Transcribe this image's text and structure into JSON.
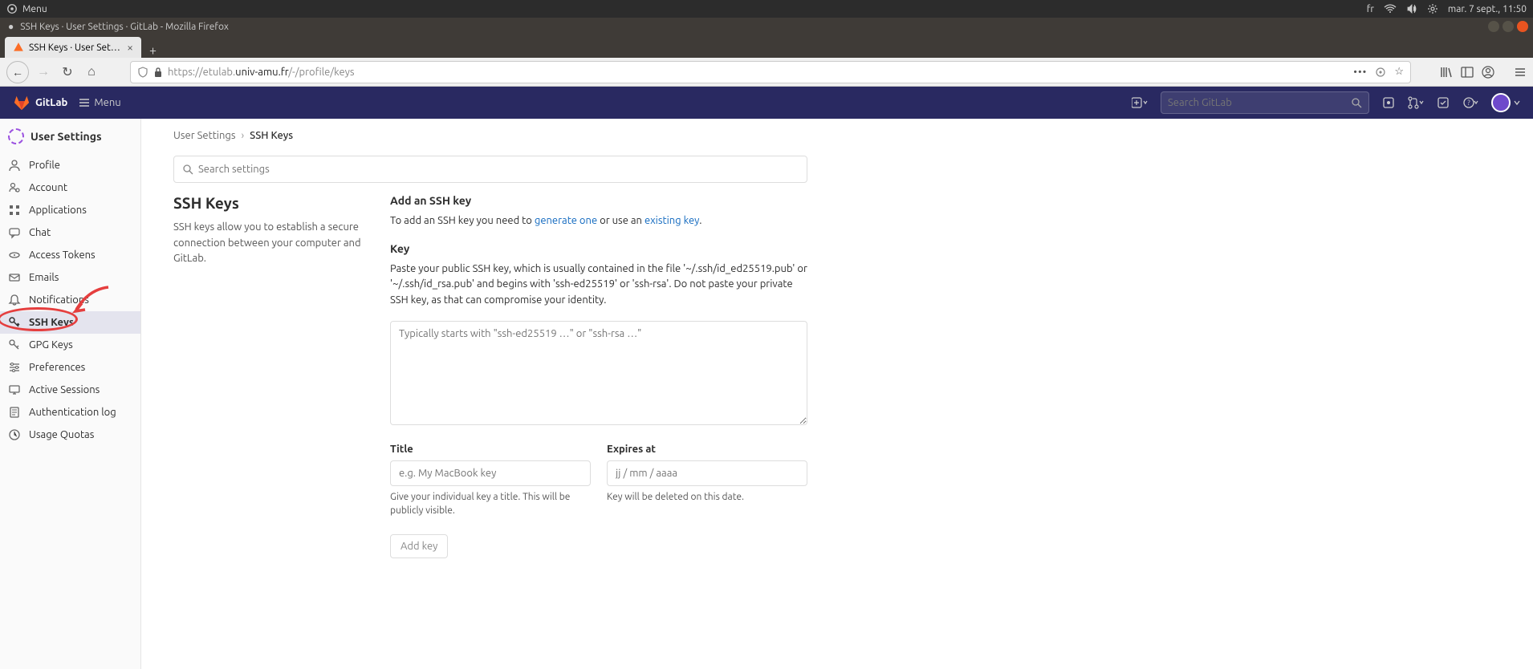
{
  "os": {
    "menu": "Menu",
    "lang": "fr",
    "date": "mar. 7 sept., 11:50"
  },
  "window": {
    "title": "SSH Keys · User Settings · GitLab - Mozilla Firefox"
  },
  "firefox": {
    "tab_title": "SSH Keys · User Settings",
    "url_proto": "https://",
    "url_host_grey1": "etulab.",
    "url_host_dark": "univ-amu.fr",
    "url_path": "/-/profile/keys"
  },
  "gitlab": {
    "brand": "GitLab",
    "menu_label": "Menu",
    "search_placeholder": "Search GitLab"
  },
  "sidebar": {
    "head": "User Settings",
    "items": [
      {
        "label": "Profile"
      },
      {
        "label": "Account"
      },
      {
        "label": "Applications"
      },
      {
        "label": "Chat"
      },
      {
        "label": "Access Tokens"
      },
      {
        "label": "Emails"
      },
      {
        "label": "Notifications"
      },
      {
        "label": "SSH Keys"
      },
      {
        "label": "GPG Keys"
      },
      {
        "label": "Preferences"
      },
      {
        "label": "Active Sessions"
      },
      {
        "label": "Authentication log"
      },
      {
        "label": "Usage Quotas"
      }
    ]
  },
  "breadcrumb": {
    "root": "User Settings",
    "current": "SSH Keys"
  },
  "page": {
    "search_placeholder": "Search settings",
    "heading": "SSH Keys",
    "heading_desc": "SSH keys allow you to establish a secure connection between your computer and GitLab.",
    "add_title": "Add an SSH key",
    "add_text_1": "To add an SSH key you need to ",
    "add_link_1": "generate one",
    "add_text_2": " or use an ",
    "add_link_2": "existing key",
    "add_text_3": ".",
    "key_label": "Key",
    "key_help": "Paste your public SSH key, which is usually contained in the file '~/.ssh/id_ed25519.pub' or '~/.ssh/id_rsa.pub' and begins with 'ssh-ed25519' or 'ssh-rsa'. Do not paste your private SSH key, as that can compromise your identity.",
    "key_placeholder": "Typically starts with \"ssh-ed25519 …\" or \"ssh-rsa …\"",
    "title_label": "Title",
    "title_placeholder": "e.g. My MacBook key",
    "title_hint": "Give your individual key a title. This will be publicly visible.",
    "expires_label": "Expires at",
    "expires_placeholder": "jj / mm / aaaa",
    "expires_hint": "Key will be deleted on this date.",
    "add_btn": "Add key"
  }
}
